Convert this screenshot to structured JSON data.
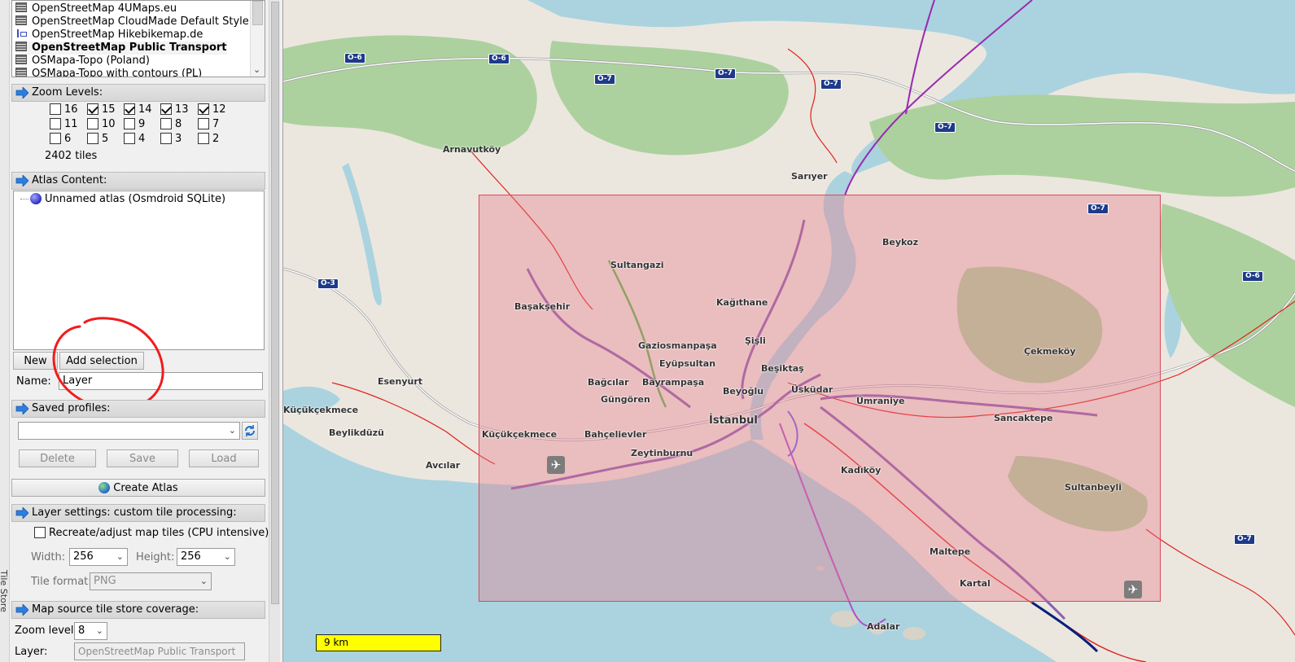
{
  "map_sources": {
    "items": [
      {
        "label": "OpenStreetMap 4UMaps.eu",
        "icon": "tile-source-icon"
      },
      {
        "label": "OpenStreetMap CloudMade Default Style",
        "icon": "tile-source-icon"
      },
      {
        "label": "OpenStreetMap Hikebikemap.de",
        "icon": "route-icon"
      },
      {
        "label": "OpenStreetMap Public Transport",
        "icon": "tile-source-icon",
        "selected": true
      },
      {
        "label": "OSMapa-Topo (Poland)",
        "icon": "tile-source-icon"
      },
      {
        "label": "OSMapa-Topo with contours (PL)",
        "icon": "tile-source-icon"
      }
    ]
  },
  "zoom_levels": {
    "title": "Zoom Levels:",
    "levels": [
      {
        "label": "16",
        "checked": false
      },
      {
        "label": "15",
        "checked": true
      },
      {
        "label": "14",
        "checked": true
      },
      {
        "label": "13",
        "checked": true
      },
      {
        "label": "12",
        "checked": true
      },
      {
        "label": "11",
        "checked": false
      },
      {
        "label": "10",
        "checked": false
      },
      {
        "label": "9",
        "checked": false
      },
      {
        "label": "8",
        "checked": false
      },
      {
        "label": "7",
        "checked": false
      },
      {
        "label": "6",
        "checked": false
      },
      {
        "label": "5",
        "checked": false
      },
      {
        "label": "4",
        "checked": false
      },
      {
        "label": "3",
        "checked": false
      },
      {
        "label": "2",
        "checked": false
      }
    ],
    "tile_count": "2402 tiles"
  },
  "atlas_content": {
    "title": "Atlas Content:",
    "atlas_name": "Unnamed atlas (Osmdroid SQLite)",
    "new_button": "New",
    "add_selection_button": "Add selection",
    "name_label": "Name:",
    "name_value": "Layer"
  },
  "saved_profiles": {
    "title": "Saved profiles:",
    "selected": "",
    "delete_button": "Delete",
    "save_button": "Save",
    "load_button": "Load"
  },
  "create_atlas_button": "Create Atlas",
  "layer_settings": {
    "title": "Layer settings: custom tile processing:",
    "recreate_label": "Recreate/adjust map tiles (CPU intensive)",
    "width_label": "Width:",
    "width_value": "256",
    "height_label": "Height:",
    "height_value": "256",
    "tile_format_label": "Tile format:",
    "tile_format_value": "PNG"
  },
  "coverage": {
    "title": "Map source tile store coverage:",
    "zoom_label": "Zoom level:",
    "zoom_value": "8",
    "layer_label": "Layer:",
    "layer_value": "OpenStreetMap Public Transport"
  },
  "side_strip_text": "Tile Store",
  "map": {
    "scale": "9 km",
    "places": [
      "Arnavutköy",
      "Sarıyer",
      "Beykoz",
      "Sultangazi",
      "Kağıthane",
      "Başakşehir",
      "Gaziosmanpaşa",
      "Şişli",
      "Eyüpsultan",
      "Beşiktaş",
      "Bağcılar",
      "Bayrampaşa",
      "Güngören",
      "Beyoğlu",
      "Üsküdar",
      "Ümraniye",
      "İstanbul",
      "Esenyurt",
      "Küçükçekmece",
      "Beylikdüzü",
      "Küçükçekmece",
      "Bahçelievler",
      "Zeytinburnu",
      "Avcılar",
      "Kadıköy",
      "Sancaktepe",
      "Çekmeköy",
      "Sultanbeyli",
      "Maltepe",
      "Kartal",
      "Adalar"
    ],
    "road_signs": [
      "O-6",
      "O-6",
      "O-7",
      "O-7",
      "O-7",
      "O-7",
      "O-7",
      "O-6",
      "O-3",
      "O-7"
    ],
    "colors": {
      "sea": "#aad3df",
      "land": "#ebe7df",
      "forest": "#add19e",
      "selection": "#eb788c",
      "transit": "#9a2bb0",
      "rail": "#e0221c"
    }
  }
}
